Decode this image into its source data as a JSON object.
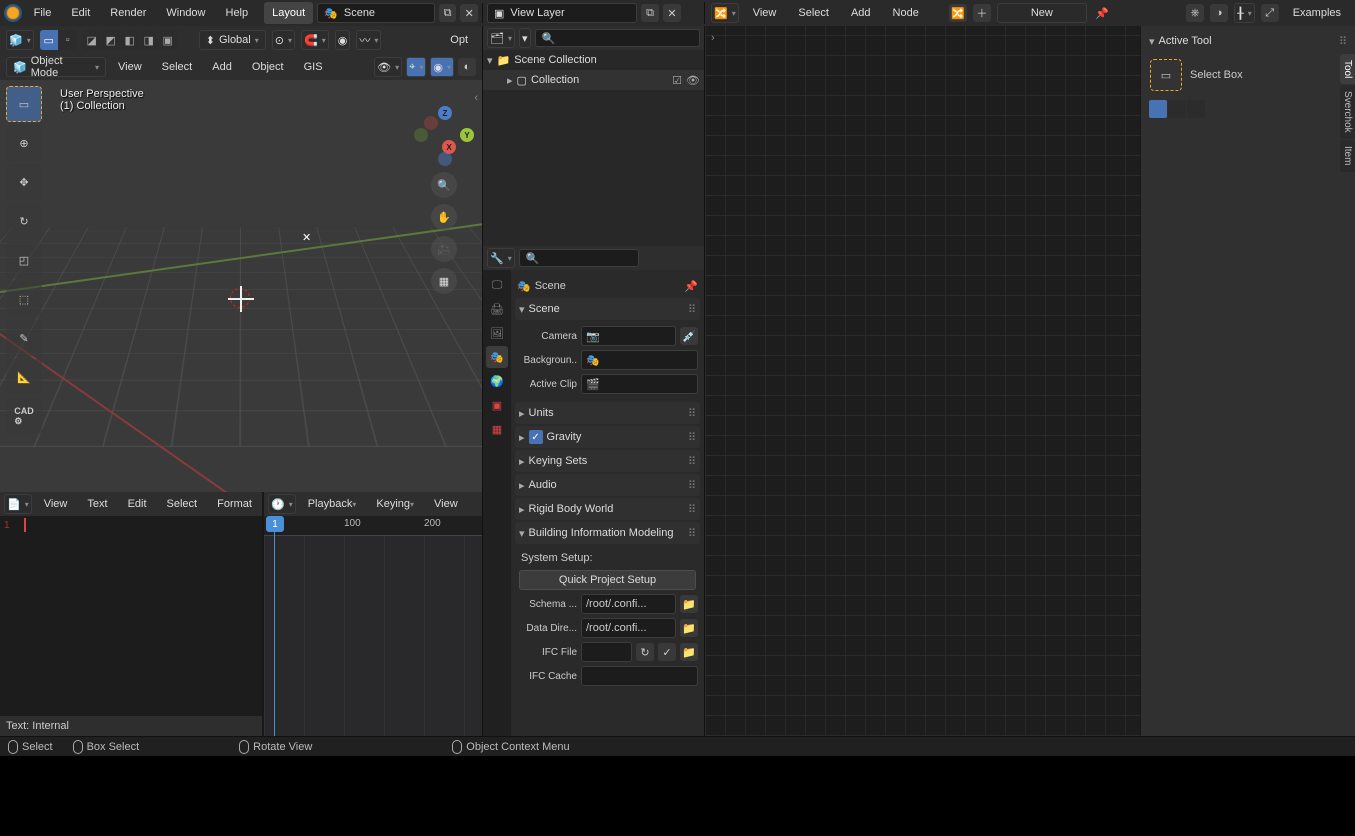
{
  "top": {
    "main_menu": [
      "File",
      "Edit",
      "Render",
      "Window",
      "Help"
    ],
    "workspace": "Layout",
    "scene": "Scene",
    "view_layer": "View Layer"
  },
  "node_header": {
    "menus": [
      "View",
      "Select",
      "Add",
      "Node"
    ],
    "new_label": "New",
    "examples": "Examples"
  },
  "viewport": {
    "mode": "Object Mode",
    "header_menus": [
      "View",
      "Select",
      "Add",
      "Object",
      "GIS"
    ],
    "orient": "Global",
    "options": "Opt",
    "overlay_line1": "User Perspective",
    "overlay_line2": "(1) Collection",
    "gizmo": {
      "x": "X",
      "y": "Y",
      "z": "Z"
    },
    "tool_names": [
      "select-box",
      "cursor",
      "move",
      "rotate",
      "scale",
      "transform",
      "annotate",
      "measure",
      "cad"
    ]
  },
  "text_editor": {
    "menus": [
      "View",
      "Text",
      "Edit",
      "Select",
      "Format"
    ],
    "line_number": "1",
    "footer": "Text: Internal"
  },
  "timeline": {
    "menus": [
      "Playback",
      "Keying",
      "View"
    ],
    "frame": "1",
    "ticks": [
      "100",
      "200"
    ]
  },
  "outliner": {
    "root": "Scene Collection",
    "child": "Collection",
    "search_placeholder": ""
  },
  "properties": {
    "context": "Scene",
    "panelScene": "Scene",
    "camera_label": "Camera",
    "background_label": "Backgroun..",
    "clip_label": "Active Clip",
    "units": "Units",
    "gravity": "Gravity",
    "keying": "Keying Sets",
    "audio": "Audio",
    "rigid": "Rigid Body World",
    "bim": "Building Information Modeling",
    "system_setup": "System Setup:",
    "quick_setup": "Quick Project Setup",
    "schema_label": "Schema ...",
    "schema_val": "/root/.confi...",
    "data_dir_label": "Data Dire...",
    "data_dir_val": "/root/.confi...",
    "ifc_file_label": "IFC File",
    "ifc_cache_label": "IFC Cache"
  },
  "npanel": {
    "title": "Active Tool",
    "tool": "Select Box",
    "tabs": [
      "Tool",
      "Sverchok",
      "Item"
    ]
  },
  "status": {
    "select": "Select",
    "box_select": "Box Select",
    "rotate": "Rotate View",
    "context": "Object Context Menu"
  }
}
